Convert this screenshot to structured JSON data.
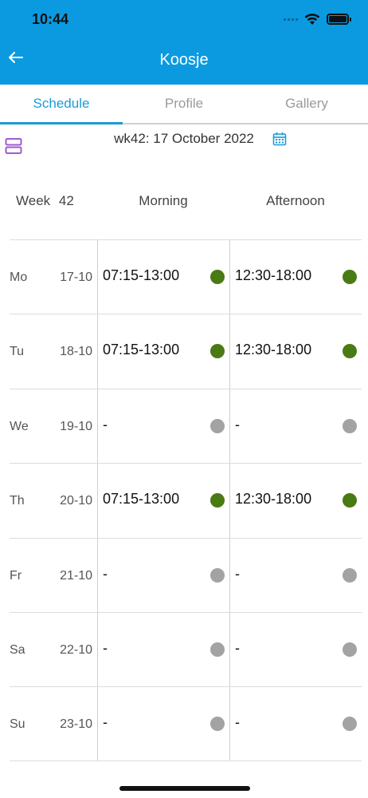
{
  "status_bar": {
    "time": "10:44"
  },
  "nav": {
    "title": "Koosje"
  },
  "tabs": [
    {
      "label": "Schedule",
      "active": true
    },
    {
      "label": "Profile",
      "active": false
    },
    {
      "label": "Gallery",
      "active": false
    }
  ],
  "week_header": {
    "title": "wk42: 17 October 2022"
  },
  "table": {
    "week_label": "Week",
    "week_number": "42",
    "morning_label": "Morning",
    "afternoon_label": "Afternoon",
    "rows": [
      {
        "day": "Mo",
        "date": "17-10",
        "morning": "07:15-13:00",
        "morning_status": "green",
        "afternoon": "12:30-18:00",
        "afternoon_status": "green"
      },
      {
        "day": "Tu",
        "date": "18-10",
        "morning": "07:15-13:00",
        "morning_status": "green",
        "afternoon": "12:30-18:00",
        "afternoon_status": "green"
      },
      {
        "day": "We",
        "date": "19-10",
        "morning": "-",
        "morning_status": "gray",
        "afternoon": "-",
        "afternoon_status": "gray"
      },
      {
        "day": "Th",
        "date": "20-10",
        "morning": "07:15-13:00",
        "morning_status": "green",
        "afternoon": "12:30-18:00",
        "afternoon_status": "green"
      },
      {
        "day": "Fr",
        "date": "21-10",
        "morning": "-",
        "morning_status": "gray",
        "afternoon": "-",
        "afternoon_status": "gray"
      },
      {
        "day": "Sa",
        "date": "22-10",
        "morning": "-",
        "morning_status": "gray",
        "afternoon": "-",
        "afternoon_status": "gray"
      },
      {
        "day": "Su",
        "date": "23-10",
        "morning": "-",
        "morning_status": "gray",
        "afternoon": "-",
        "afternoon_status": "gray"
      }
    ]
  },
  "colors": {
    "header": "#0b9ae0",
    "tab_active": "#1a9bd7",
    "status_green": "#4a7a14",
    "status_gray": "#a3a3a3",
    "view_toggle_icon": "#a05ad0"
  },
  "icons": {
    "back": "arrow-left-icon",
    "view_toggle": "rows-view-icon",
    "calendar": "calendar-icon",
    "wifi": "wifi-icon",
    "battery": "battery-icon",
    "signal": "cellular-signal-icon"
  }
}
